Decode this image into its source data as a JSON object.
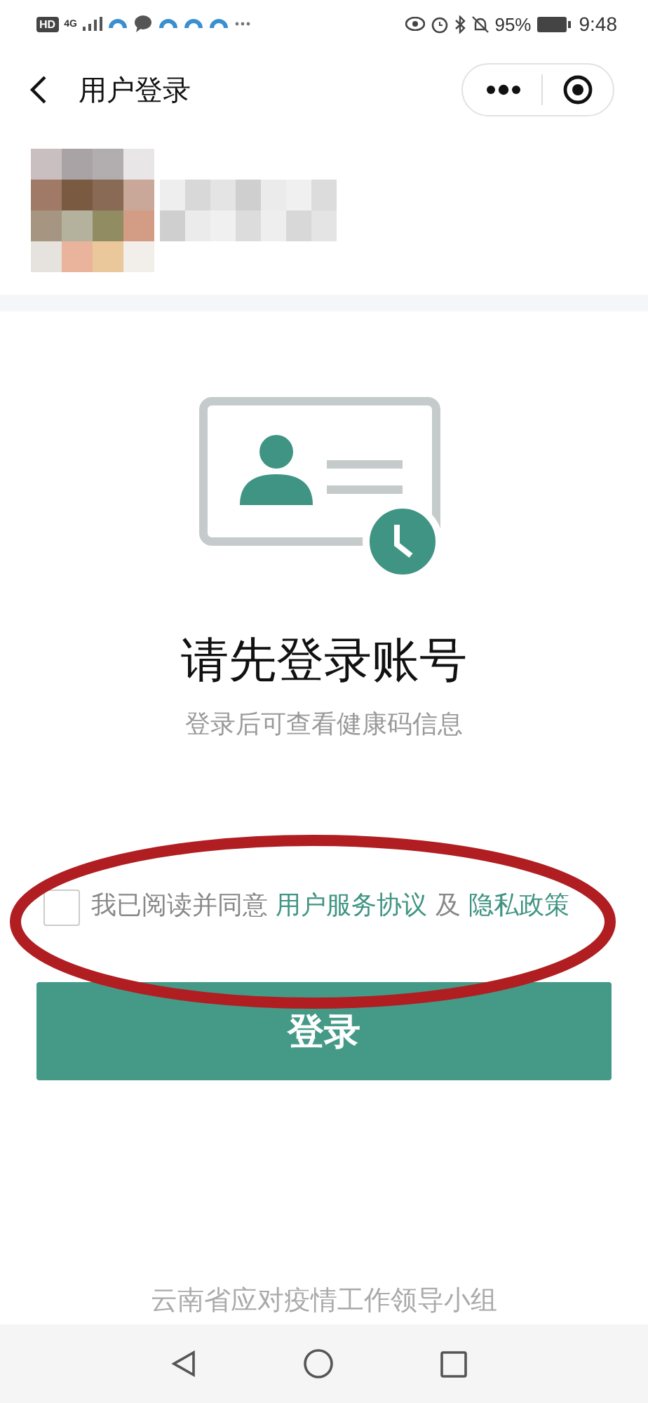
{
  "status_bar": {
    "hd": "HD",
    "network": "4G",
    "battery": "95%",
    "time": "9:48"
  },
  "header": {
    "title": "用户登录"
  },
  "prompt": {
    "title": "请先登录账号",
    "subtitle": "登录后可查看健康码信息"
  },
  "agreement": {
    "checked": false,
    "prefix": "我已阅读并同意",
    "conjunction": "及",
    "links": [
      "用户服务协议",
      "隐私政策"
    ]
  },
  "login_button": {
    "label": "登录"
  },
  "footer": {
    "text": "云南省应对疫情工作领导小组"
  }
}
